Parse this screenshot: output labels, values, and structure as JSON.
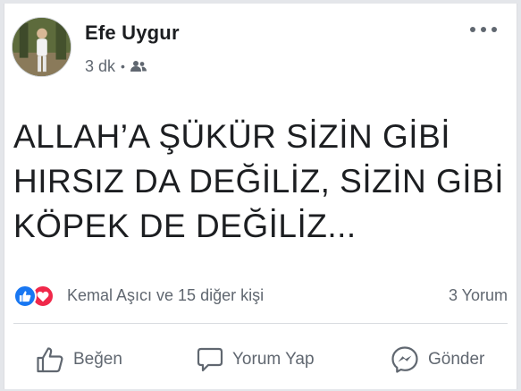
{
  "post": {
    "author": "Efe Uygur",
    "time": "3 dk",
    "separator": "•",
    "audience_icon": "friends-icon",
    "lines": [
      "ALLAH’A ŞÜKÜR SİZİN GİBİ",
      "HIRSIZ DA DEĞİLİZ, SİZİN GİBİ",
      "KÖPEK DE DEĞİLİZ..."
    ]
  },
  "reactions": {
    "summary": "Kemal Aşıcı ve 15 diğer kişi",
    "comments": "3 Yorum",
    "icons": [
      "like-reaction-icon",
      "love-reaction-icon"
    ]
  },
  "actions": {
    "like": "Beğen",
    "comment": "Yorum Yap",
    "send": "Gönder"
  },
  "colors": {
    "like_blue": "#1877f2",
    "love_red": "#f0284a",
    "secondary_text": "#606770"
  }
}
